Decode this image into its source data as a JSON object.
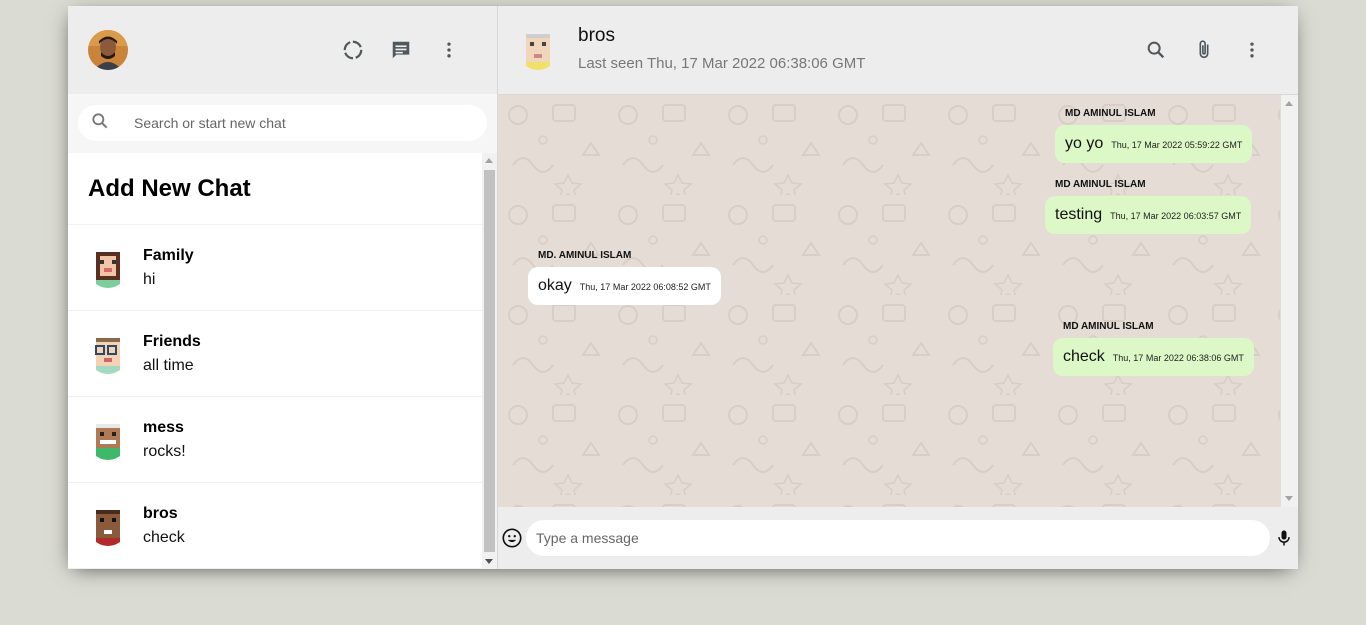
{
  "sidebar": {
    "search": {
      "placeholder": "Search or start new chat"
    },
    "add_new_chat": "Add New Chat",
    "chats": [
      {
        "name": "Family",
        "last_message": "hi",
        "avatar": "pixel-avatar-woman-brown-hair"
      },
      {
        "name": "Friends",
        "last_message": "all time",
        "avatar": "pixel-avatar-glasses"
      },
      {
        "name": "mess",
        "last_message": "rocks!",
        "avatar": "pixel-avatar-smiling"
      },
      {
        "name": "bros",
        "last_message": "check",
        "avatar": "pixel-avatar-dark-skin"
      }
    ],
    "icons": [
      "status-icon",
      "new-chat-icon",
      "more-vert-icon"
    ]
  },
  "chat": {
    "header": {
      "name": "bros",
      "last_seen": "Last seen Thu, 17 Mar 2022 06:38:06 GMT",
      "icons": [
        "search-icon",
        "attach-icon",
        "more-vert-icon"
      ]
    },
    "messages": [
      {
        "sender": "MD AMINUL ISLAM",
        "text": "yo yo",
        "time": "Thu, 17 Mar 2022 05:59:22 GMT",
        "sent": true
      },
      {
        "sender": "MD AMINUL ISLAM",
        "text": "testing",
        "time": "Thu, 17 Mar 2022 06:03:57 GMT",
        "sent": true
      },
      {
        "sender": "MD. AMINUL ISLAM",
        "text": "okay",
        "time": "Thu, 17 Mar 2022 06:08:52 GMT",
        "sent": false
      },
      {
        "sender": "MD AMINUL ISLAM",
        "text": "check",
        "time": "Thu, 17 Mar 2022 06:38:06 GMT",
        "sent": true
      }
    ],
    "footer": {
      "placeholder": "Type a message",
      "icons": [
        "emoji-icon",
        "mic-icon"
      ]
    }
  },
  "colors": {
    "page_bg": "#dadbd3",
    "panel_header": "#ededed",
    "sent_bubble": "#dcf8c6",
    "received_bubble": "#ffffff",
    "chat_bg": "#e5ddd5"
  }
}
